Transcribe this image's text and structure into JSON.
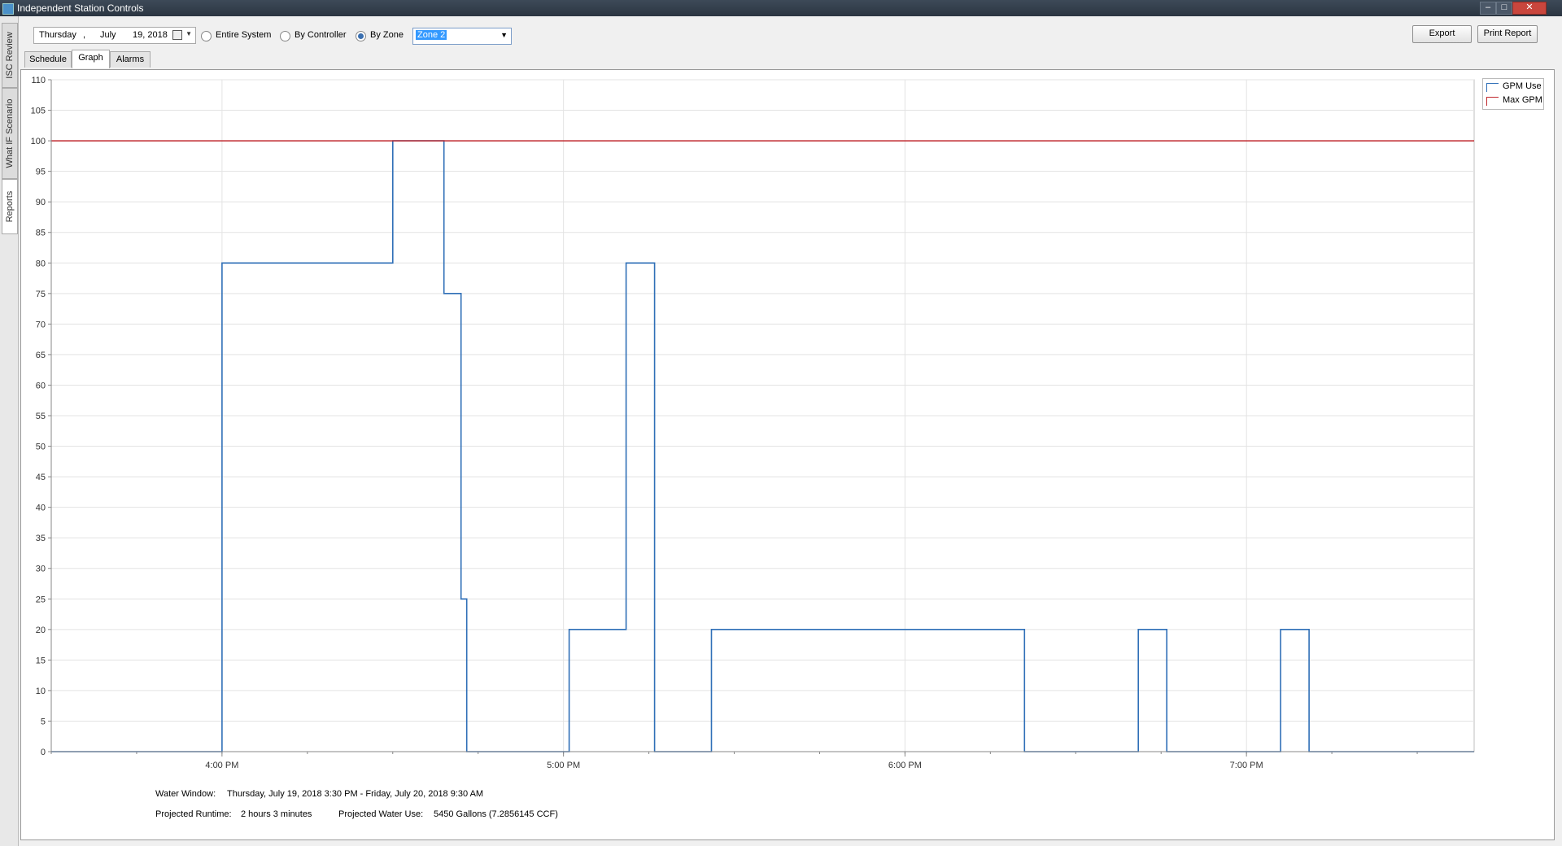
{
  "window": {
    "title": "Independent Station Controls",
    "min": "–",
    "max": "□",
    "close": "✕"
  },
  "side_tabs": [
    "ISC Review",
    "What IF Scenario",
    "Reports"
  ],
  "date_picker": {
    "weekday": "Thursday",
    "sep": ",",
    "month": "July",
    "day_year": "19, 2018",
    "calendar_icon": "calendar-icon"
  },
  "scope": {
    "entire_system": "Entire System",
    "by_controller": "By Controller",
    "by_zone": "By Zone",
    "selected": "By Zone"
  },
  "zone_select": {
    "value": "Zone 2"
  },
  "buttons": {
    "export": "Export",
    "print_report": "Print Report"
  },
  "tabs": {
    "schedule": "Schedule",
    "graph": "Graph",
    "alarms": "Alarms",
    "active": "Graph"
  },
  "chart_data": {
    "type": "line",
    "x_unit": "time",
    "x_range": [
      "3:30 PM",
      "7:40 PM"
    ],
    "x_ticks": [
      "4:00 PM",
      "5:00 PM",
      "6:00 PM",
      "7:00 PM"
    ],
    "ylim": [
      0,
      110
    ],
    "y_ticks": [
      0,
      5,
      10,
      15,
      20,
      25,
      30,
      35,
      40,
      45,
      50,
      55,
      60,
      65,
      70,
      75,
      80,
      85,
      90,
      95,
      100,
      105,
      110
    ],
    "grid": true,
    "legend_position": "top-right",
    "series": [
      {
        "name": "GPM Use",
        "color": "#2f6fb7",
        "step": true,
        "points": [
          [
            "3:30 PM",
            0
          ],
          [
            "4:00 PM",
            0
          ],
          [
            "4:00 PM",
            80
          ],
          [
            "4:30 PM",
            80
          ],
          [
            "4:30 PM",
            100
          ],
          [
            "4:39 PM",
            100
          ],
          [
            "4:39 PM",
            75
          ],
          [
            "4:42 PM",
            75
          ],
          [
            "4:42 PM",
            25
          ],
          [
            "4:43 PM",
            25
          ],
          [
            "4:43 PM",
            0
          ],
          [
            "5:01 PM",
            0
          ],
          [
            "5:01 PM",
            20
          ],
          [
            "5:11 PM",
            20
          ],
          [
            "5:11 PM",
            80
          ],
          [
            "5:16 PM",
            80
          ],
          [
            "5:16 PM",
            0
          ],
          [
            "5:26 PM",
            0
          ],
          [
            "5:26 PM",
            20
          ],
          [
            "6:21 PM",
            20
          ],
          [
            "6:21 PM",
            0
          ],
          [
            "6:41 PM",
            0
          ],
          [
            "6:41 PM",
            20
          ],
          [
            "6:46 PM",
            20
          ],
          [
            "6:46 PM",
            0
          ],
          [
            "7:06 PM",
            0
          ],
          [
            "7:06 PM",
            20
          ],
          [
            "7:11 PM",
            20
          ],
          [
            "7:11 PM",
            0
          ],
          [
            "7:40 PM",
            0
          ]
        ]
      },
      {
        "name": "Max GPM",
        "color": "#c0282d",
        "constant": 100
      }
    ]
  },
  "footer": {
    "water_window_label": "Water Window:",
    "water_window_value": "Thursday, July 19, 2018 3:30 PM - Friday, July 20, 2018 9:30 AM",
    "runtime_label": "Projected Runtime:",
    "runtime_value": "2 hours 3 minutes",
    "water_use_label": "Projected Water Use:",
    "water_use_value": "5450 Gallons (7.2856145 CCF)"
  }
}
